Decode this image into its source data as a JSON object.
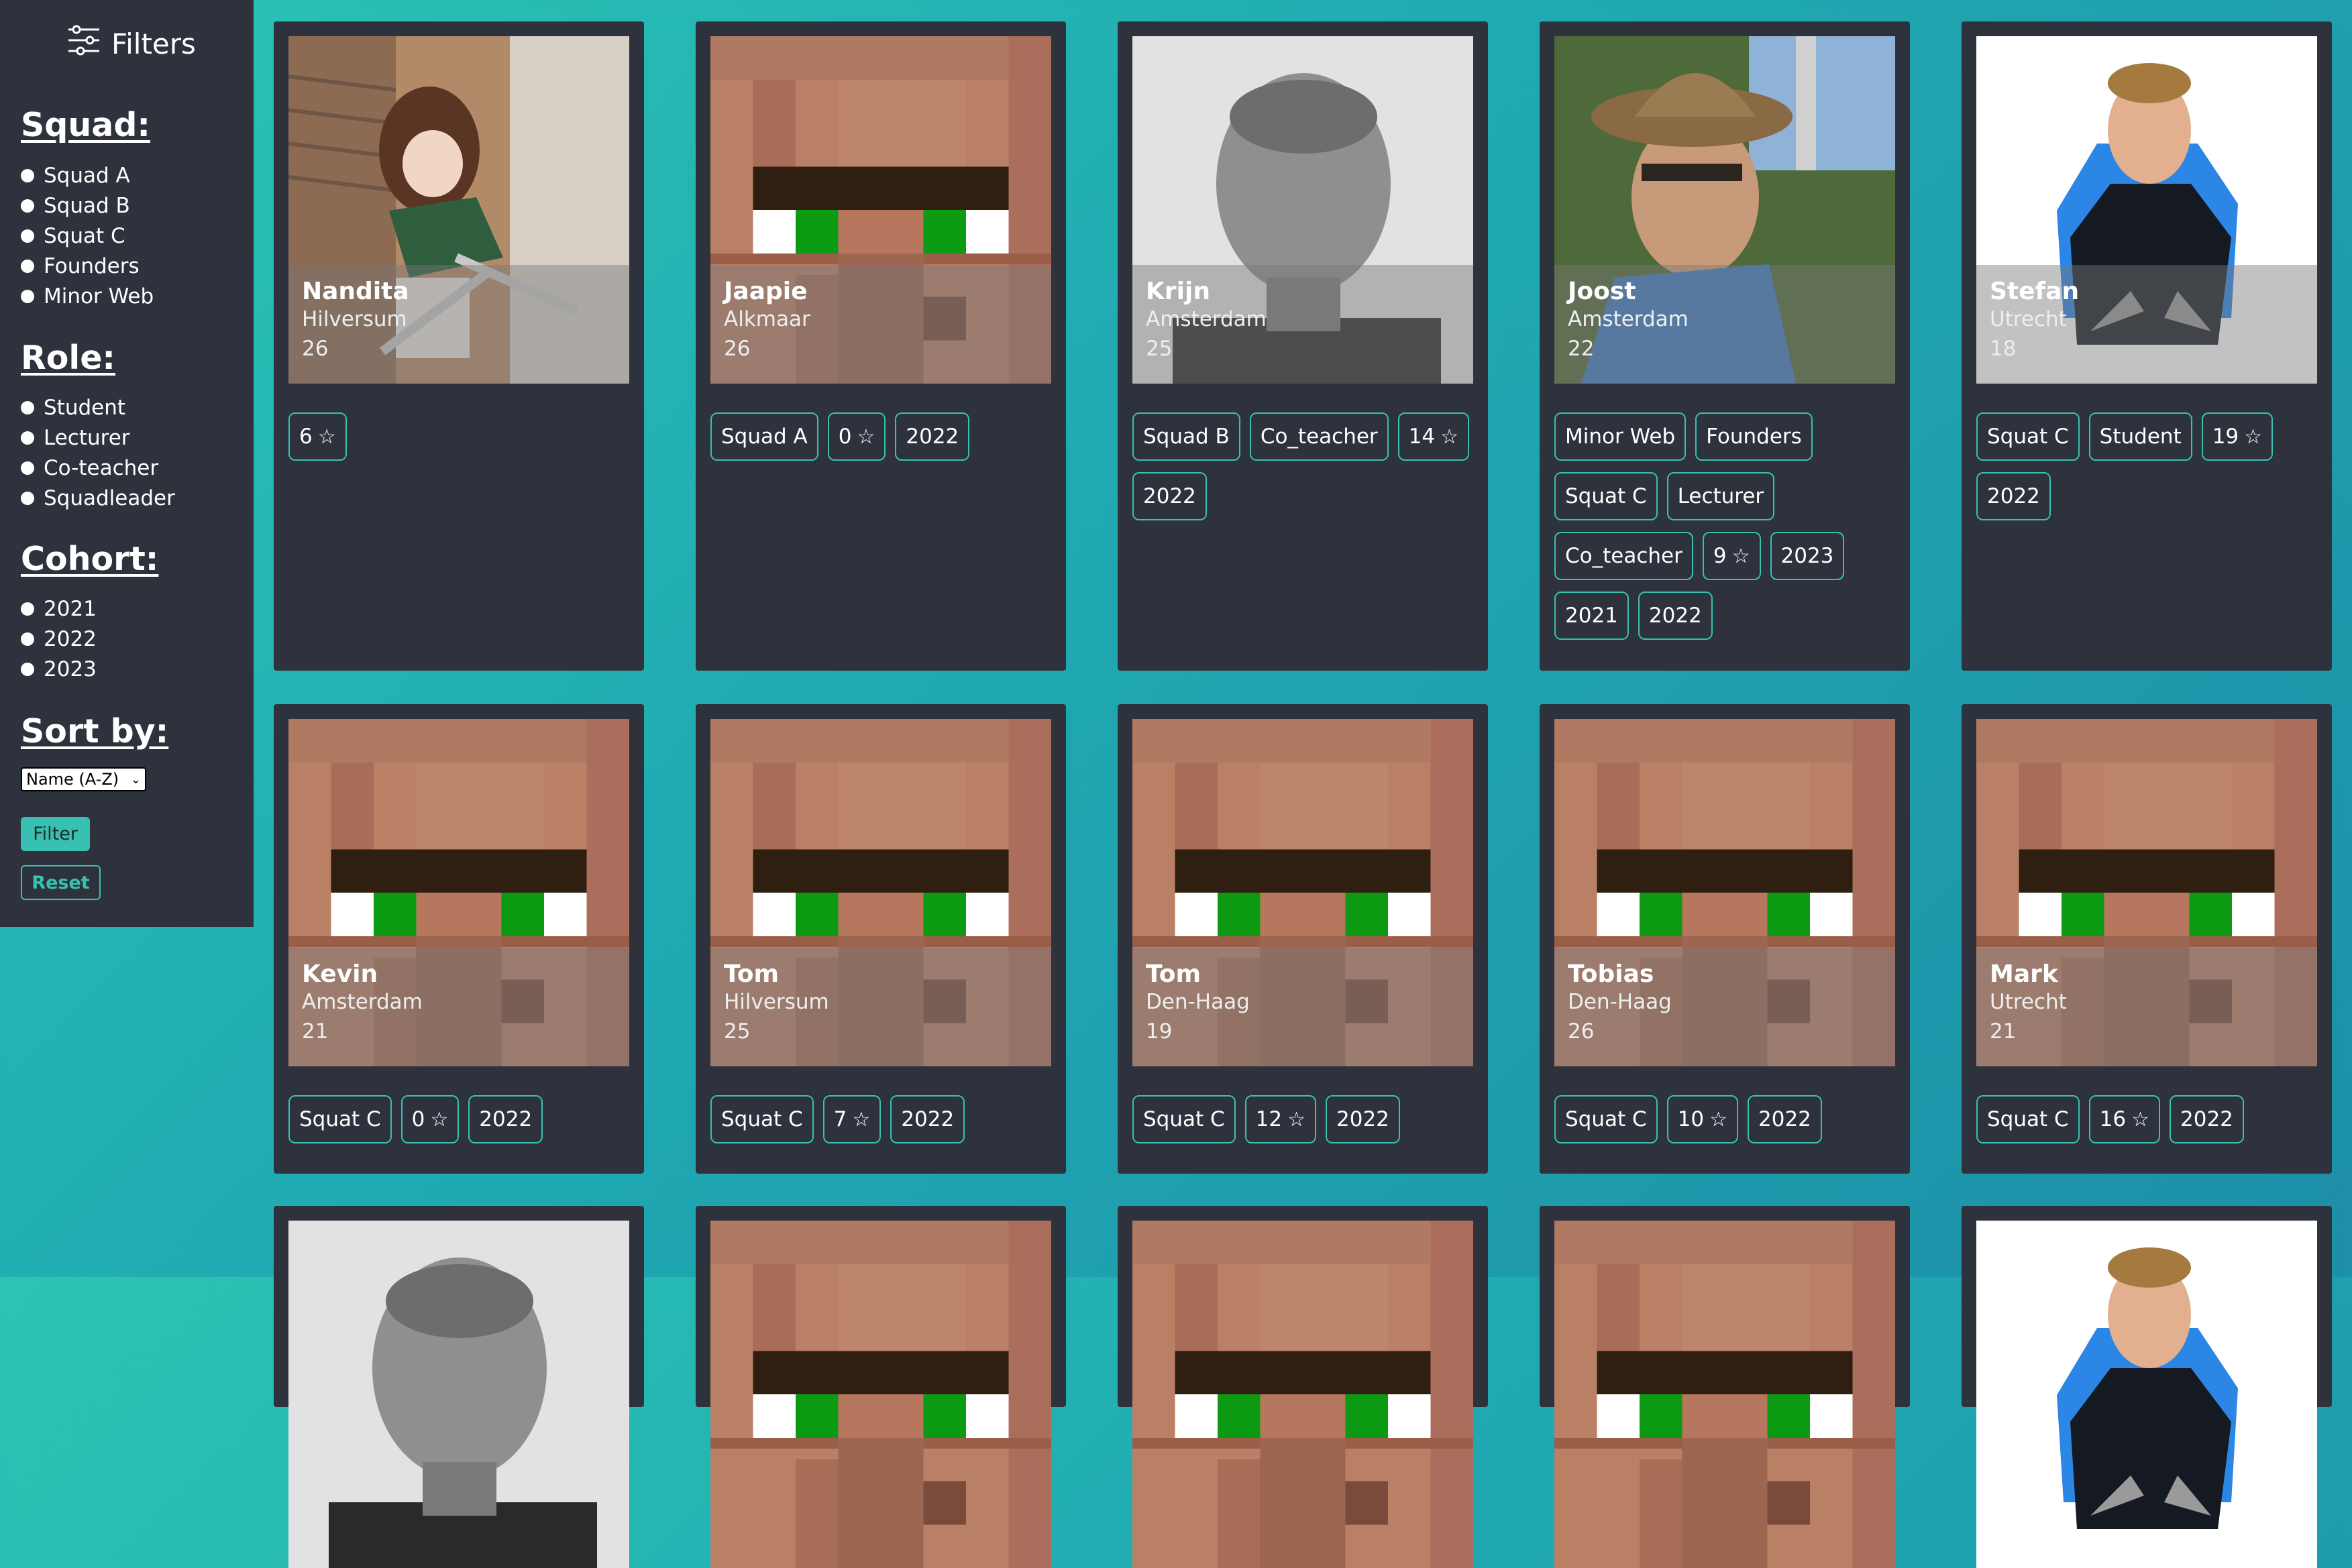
{
  "sidebar": {
    "title": "Filters",
    "squad_title": "Squad:",
    "squad_options": [
      "Squad A",
      "Squad B",
      "Squat C",
      "Founders",
      "Minor Web"
    ],
    "role_title": "Role:",
    "role_options": [
      "Student",
      "Lecturer",
      "Co-teacher",
      "Squadleader"
    ],
    "cohort_title": "Cohort:",
    "cohort_options": [
      "2021",
      "2022",
      "2023"
    ],
    "sort_title": "Sort by:",
    "sort_selected": "Name (A-Z)",
    "filter_label": "Filter",
    "reset_label": "Reset"
  },
  "colors": {
    "accent": "#38c1b2",
    "card_bg": "#2d323d",
    "sidebar_bg": "#2d323d"
  },
  "icons": {
    "filters": "sliders-icon",
    "star": "star-outline-icon",
    "chevron": "chevron-down-icon"
  },
  "cards": [
    {
      "name": "Nandita",
      "city": "Hilversum",
      "age": "26",
      "photo": "anime-figure",
      "tags": [
        {
          "t": "6",
          "star": true
        }
      ]
    },
    {
      "name": "Jaapie",
      "city": "Alkmaar",
      "age": "26",
      "photo": "villager",
      "tags": [
        {
          "t": "Squad A"
        },
        {
          "t": "0",
          "star": true
        },
        {
          "t": "2022"
        }
      ]
    },
    {
      "name": "Krijn",
      "city": "Amsterdam",
      "age": "25",
      "photo": "bw-portrait",
      "tags": [
        {
          "t": "Squad B"
        },
        {
          "t": "Co_teacher"
        },
        {
          "t": "14",
          "star": true
        },
        {
          "t": "2022"
        }
      ]
    },
    {
      "name": "Joost",
      "city": "Amsterdam",
      "age": "22",
      "photo": "hat-portrait",
      "tags": [
        {
          "t": "Minor Web"
        },
        {
          "t": "Founders"
        },
        {
          "t": "Squat C"
        },
        {
          "t": "Lecturer"
        },
        {
          "t": "Co_teacher"
        },
        {
          "t": "9",
          "star": true
        },
        {
          "t": "2023"
        },
        {
          "t": "2021"
        },
        {
          "t": "2022"
        }
      ]
    },
    {
      "name": "Stefan",
      "city": "Utrecht",
      "age": "18",
      "photo": "cutout-portrait",
      "tags": [
        {
          "t": "Squat C"
        },
        {
          "t": "Student"
        },
        {
          "t": "19",
          "star": true
        },
        {
          "t": "2022"
        }
      ]
    },
    {
      "name": "Kevin",
      "city": "Amsterdam",
      "age": "21",
      "photo": "villager",
      "tags": [
        {
          "t": "Squat C"
        },
        {
          "t": "0",
          "star": true
        },
        {
          "t": "2022"
        }
      ]
    },
    {
      "name": "Tom",
      "city": "Hilversum",
      "age": "25",
      "photo": "villager",
      "tags": [
        {
          "t": "Squat C"
        },
        {
          "t": "7",
          "star": true
        },
        {
          "t": "2022"
        }
      ]
    },
    {
      "name": "Tom",
      "city": "Den-Haag",
      "age": "19",
      "photo": "villager",
      "tags": [
        {
          "t": "Squat C"
        },
        {
          "t": "12",
          "star": true
        },
        {
          "t": "2022"
        }
      ]
    },
    {
      "name": "Tobias",
      "city": "Den-Haag",
      "age": "26",
      "photo": "villager",
      "tags": [
        {
          "t": "Squat C"
        },
        {
          "t": "10",
          "star": true
        },
        {
          "t": "2022"
        }
      ]
    },
    {
      "name": "Mark",
      "city": "Utrecht",
      "age": "21",
      "photo": "villager",
      "tags": [
        {
          "t": "Squat C"
        },
        {
          "t": "16",
          "star": true
        },
        {
          "t": "2022"
        }
      ]
    }
  ]
}
